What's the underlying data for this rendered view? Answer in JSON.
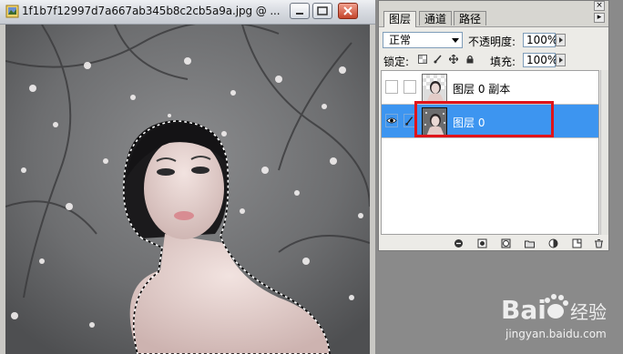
{
  "document": {
    "title": "1f1b7f12997d7a667ab345b8c2cb5a9a.jpg @ ...",
    "icon": "photoshop-document-icon",
    "window_buttons": [
      "minimize-icon",
      "maximize-icon",
      "close-icon"
    ]
  },
  "layers_panel": {
    "tabs": [
      {
        "label": "图层",
        "active": true
      },
      {
        "label": "通道",
        "active": false
      },
      {
        "label": "路径",
        "active": false
      }
    ],
    "blend_mode": "正常",
    "opacity_label": "不透明度:",
    "opacity_value": "100%",
    "lock_label": "锁定:",
    "lock_icons": [
      "lock-transparent-icon",
      "lock-paint-icon",
      "lock-move-icon",
      "lock-all-icon"
    ],
    "fill_label": "填充:",
    "fill_value": "100%",
    "layers": [
      {
        "name": "图层 0 副本",
        "visible": false,
        "selected": false
      },
      {
        "name": "图层 0",
        "visible": true,
        "selected": true
      }
    ],
    "footer_icons": [
      "link-layers-icon",
      "add-style-icon",
      "add-mask-icon",
      "new-group-icon",
      "adjustment-layer-icon",
      "new-layer-icon",
      "delete-layer-icon"
    ]
  },
  "watermark": {
    "brand": "Bai",
    "brand_suffix": "经验",
    "url": "jingyan.baidu.com"
  },
  "colors": {
    "selected_layer": "#3d95f0",
    "highlight_box": "#e0141a",
    "close_button": "#c4452b"
  }
}
